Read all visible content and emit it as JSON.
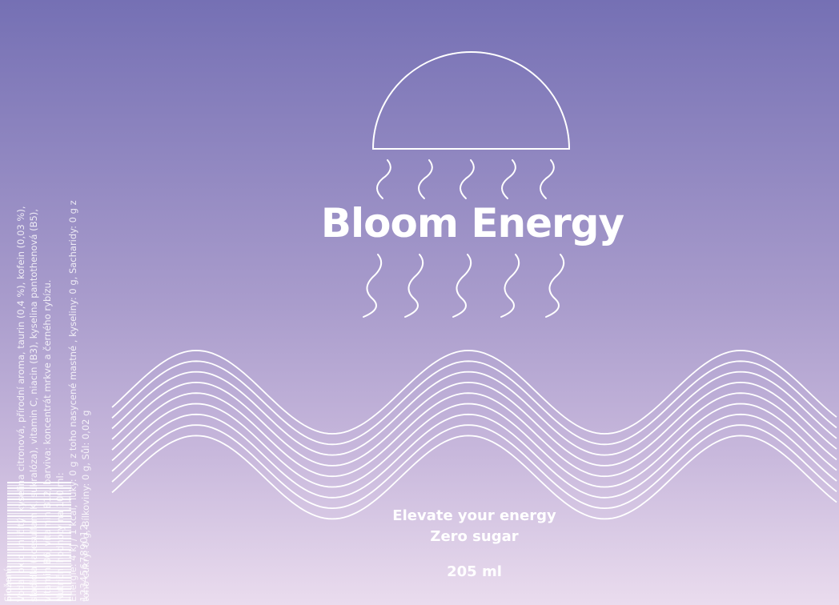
{
  "label": {
    "brand_name": "Bloom Energy",
    "tagline_1": "Elevate your energy",
    "tagline_2": "Zero sugar",
    "volume": "205 ml"
  },
  "ingredients": {
    "lines": [
      "Složení:",
      "Voda, oxid uhličitý, kyselina citronová, přírodní aroma, taurin (0,4 %), kofein (0,03 %),",
      "sladidla (acesulfam K, sukralóza), vitamin C, niacin (B3), kyselina pantothenová (B5),",
      "vitamin B6, vitamin B12, barviva: koncentrát mrkve a černého rybízu.",
      "Nutriční hodnoty na 100 ml:",
      "Energie: 4 kJ / 1 kcal, Tuky: 0 g z toho nasycené mastné , kyseliny: 0 g, Sacharidy: 0 g z",
      "toho cukry: 0 g, Bílkoviny: 0 g, Sůl: 0,02 g"
    ]
  },
  "barcode": {
    "number": "123456789012"
  },
  "colors": {
    "top": "#7570b4",
    "bottom": "#eadcee",
    "line": "#ffffff"
  },
  "icons": {
    "logo": "jellyfish-icon"
  }
}
